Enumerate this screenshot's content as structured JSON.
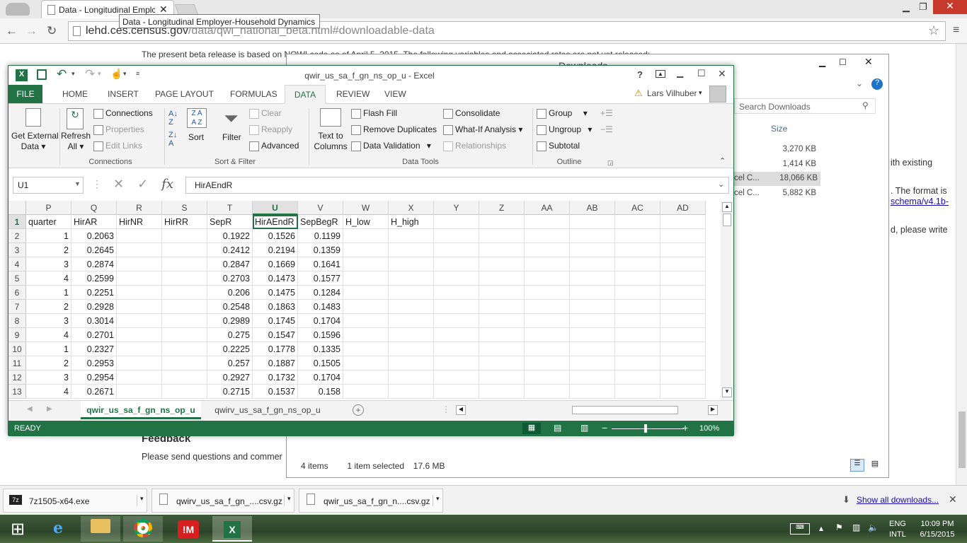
{
  "browser": {
    "tab_title": "Data - Longitudinal Emplc",
    "tooltip": "Data - Longitudinal Employer-Household Dynamics",
    "url_host": "lehd.ces.census.gov",
    "url_path": "/data/qwi_national_beta.html#downloadable-data"
  },
  "page": {
    "beta_text": "The present beta release is based on NQWI code as of April 5, 2015. The following variables and associated rates are not yet released:",
    "feedback_heading": "Feedback",
    "feedback_text": "Please send questions and commer",
    "right_text_1": "ith existing",
    "right_text_2": ". The format is",
    "right_link": "schema/v4.1b-",
    "right_text_3": "d, please write"
  },
  "downloads_window": {
    "title": "Downloads",
    "search_placeholder": "Search Downloads",
    "size_header": "Size",
    "rows": [
      {
        "name": "",
        "size": "3,270 KB"
      },
      {
        "name": "",
        "size": "1,414 KB"
      },
      {
        "name": "cel C...",
        "size": "18,066 KB"
      },
      {
        "name": "cel C...",
        "size": "5,882 KB"
      }
    ],
    "status_items": "4 items",
    "status_selected": "1 item selected",
    "status_size": "17.6 MB"
  },
  "excel": {
    "title": "qwir_us_sa_f_gn_ns_op_u - Excel",
    "user": "Lars Vilhuber",
    "tabs": [
      "FILE",
      "HOME",
      "INSERT",
      "PAGE LAYOUT",
      "FORMULAS",
      "DATA",
      "REVIEW",
      "VIEW"
    ],
    "ribbon": {
      "get_external": "Get External",
      "data": "Data",
      "refresh": "Refresh",
      "all": "All",
      "connections": "Connections",
      "properties": "Properties",
      "edit_links": "Edit Links",
      "grp_connections": "Connections",
      "sort": "Sort",
      "filter": "Filter",
      "clear": "Clear",
      "reapply": "Reapply",
      "advanced": "Advanced",
      "grp_sort": "Sort & Filter",
      "text_to": "Text to",
      "columns": "Columns",
      "flash_fill": "Flash Fill",
      "remove_dup": "Remove Duplicates",
      "data_validation": "Data Validation",
      "consolidate": "Consolidate",
      "what_if": "What-If Analysis",
      "relationships": "Relationships",
      "grp_tools": "Data Tools",
      "group": "Group",
      "ungroup": "Ungroup",
      "subtotal": "Subtotal",
      "grp_outline": "Outline"
    },
    "name_box": "U1",
    "formula": "HirAEndR",
    "columns": [
      "P",
      "Q",
      "R",
      "S",
      "T",
      "U",
      "V",
      "W",
      "X",
      "Y",
      "Z",
      "AA",
      "AB",
      "AC",
      "AD"
    ],
    "header_row": [
      "quarter",
      "HirAR",
      "HirNR",
      "HirRR",
      "SepR",
      "HirAEndR",
      "SepBegR",
      "H_low",
      "H_high",
      "",
      "",
      "",
      "",
      "",
      ""
    ],
    "rows": [
      {
        "n": "2",
        "c": [
          "1",
          "0.2063",
          "",
          "",
          "0.1922",
          "0.1526",
          "0.1199"
        ]
      },
      {
        "n": "3",
        "c": [
          "2",
          "0.2645",
          "",
          "",
          "0.2412",
          "0.2194",
          "0.1359"
        ]
      },
      {
        "n": "4",
        "c": [
          "3",
          "0.2874",
          "",
          "",
          "0.2847",
          "0.1669",
          "0.1641"
        ]
      },
      {
        "n": "5",
        "c": [
          "4",
          "0.2599",
          "",
          "",
          "0.2703",
          "0.1473",
          "0.1577"
        ]
      },
      {
        "n": "6",
        "c": [
          "1",
          "0.2251",
          "",
          "",
          "0.206",
          "0.1475",
          "0.1284"
        ]
      },
      {
        "n": "7",
        "c": [
          "2",
          "0.2928",
          "",
          "",
          "0.2548",
          "0.1863",
          "0.1483"
        ]
      },
      {
        "n": "8",
        "c": [
          "3",
          "0.3014",
          "",
          "",
          "0.2989",
          "0.1745",
          "0.1704"
        ]
      },
      {
        "n": "9",
        "c": [
          "4",
          "0.2701",
          "",
          "",
          "0.275",
          "0.1547",
          "0.1596"
        ]
      },
      {
        "n": "10",
        "c": [
          "1",
          "0.2327",
          "",
          "",
          "0.2225",
          "0.1778",
          "0.1335"
        ]
      },
      {
        "n": "11",
        "c": [
          "2",
          "0.2953",
          "",
          "",
          "0.257",
          "0.1887",
          "0.1505"
        ]
      },
      {
        "n": "12",
        "c": [
          "3",
          "0.2954",
          "",
          "",
          "0.2927",
          "0.1732",
          "0.1704"
        ]
      },
      {
        "n": "13",
        "c": [
          "4",
          "0.2671",
          "",
          "",
          "0.2715",
          "0.1537",
          "0.158"
        ]
      }
    ],
    "sheets": [
      "qwir_us_sa_f_gn_ns_op_u",
      "qwirv_us_sa_f_gn_ns_op_u"
    ],
    "status": "READY",
    "zoom": "100%"
  },
  "downloads_bar": {
    "items": [
      "7z1505-x64.exe",
      "qwirv_us_sa_f_gn_....csv.gz",
      "qwir_us_sa_f_gn_n....csv.gz"
    ],
    "show_all": "Show all downloads..."
  },
  "taskbar": {
    "lang1": "ENG",
    "lang2": "INTL",
    "time": "10:09 PM",
    "date": "6/15/2015"
  },
  "colors": {
    "excel_green": "#217346",
    "close_red": "#c7392a"
  }
}
